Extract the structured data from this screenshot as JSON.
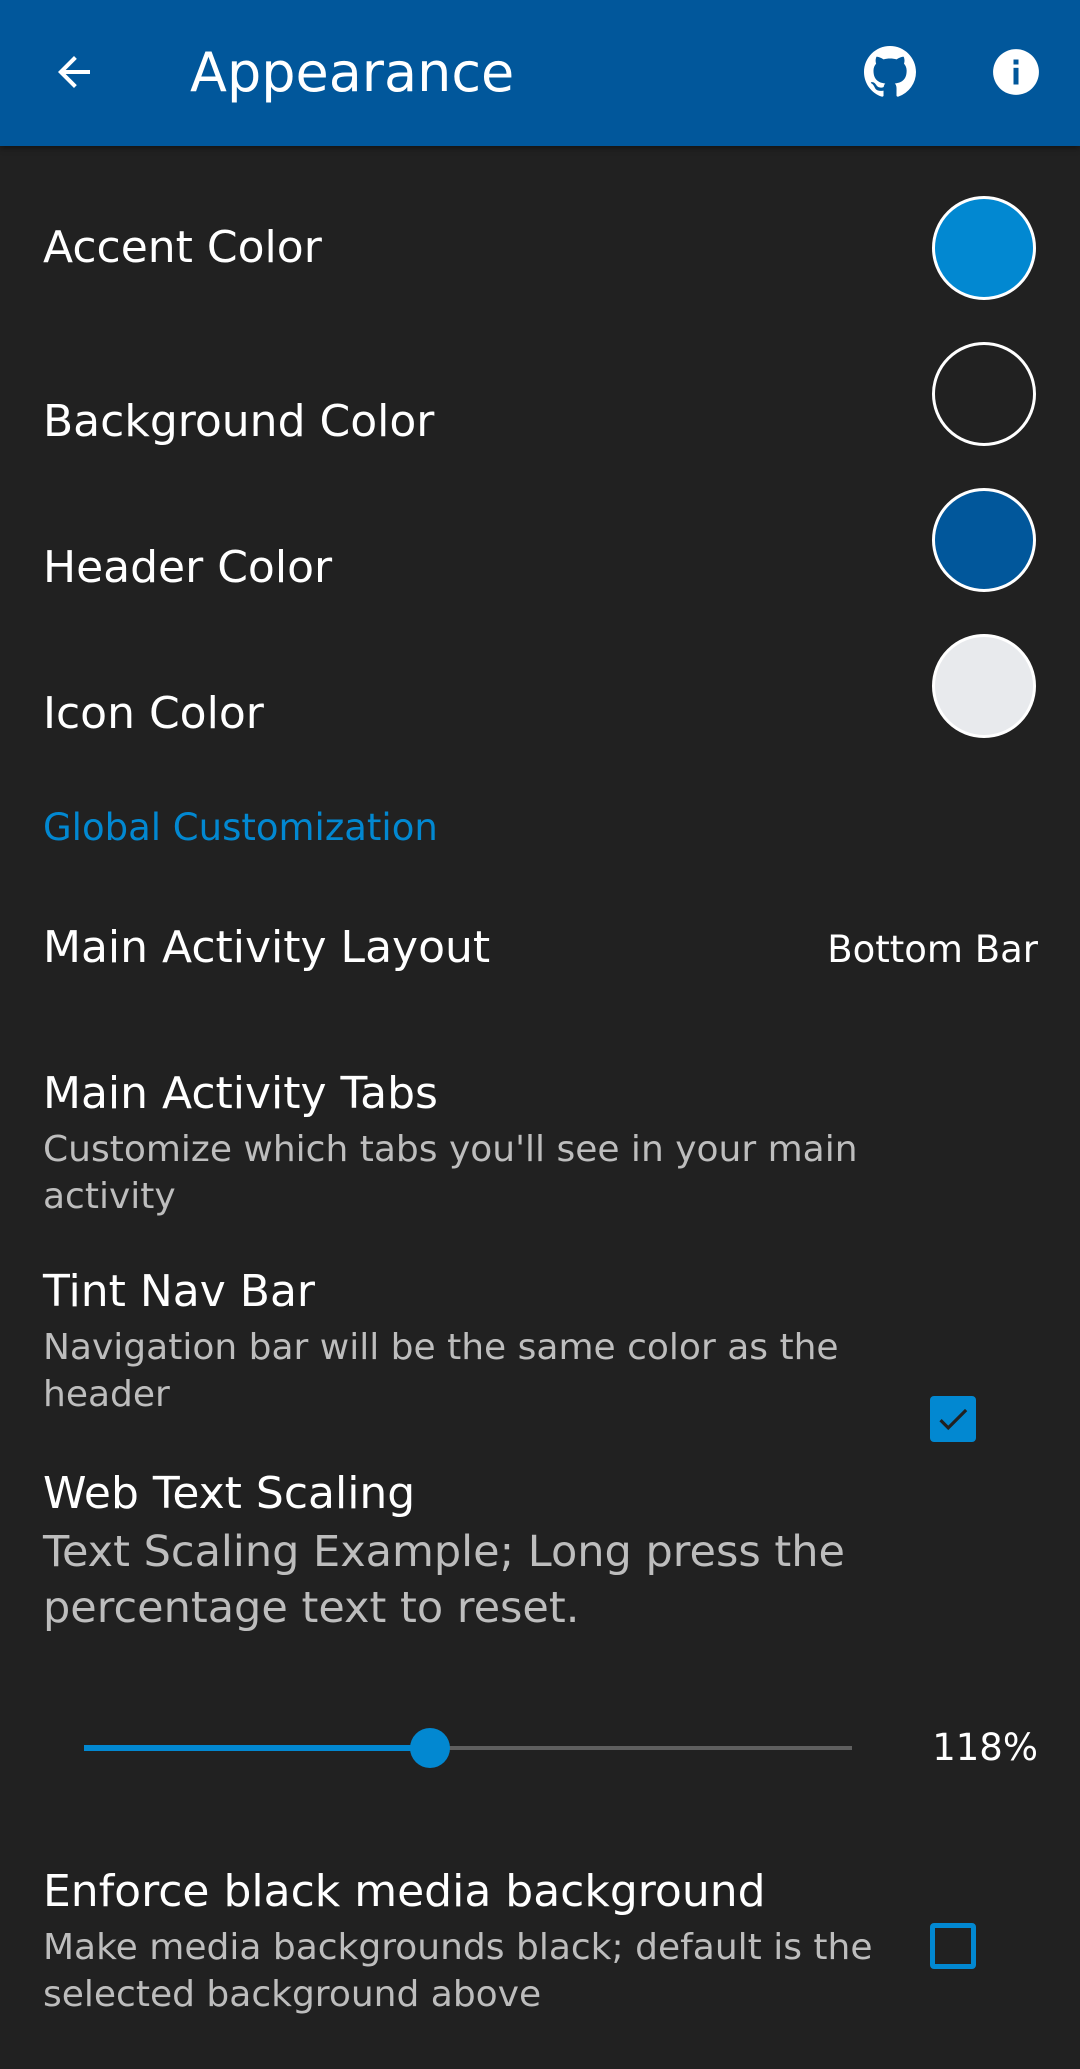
{
  "app_bar": {
    "title": "Appearance",
    "back_icon": "arrow-back-icon",
    "actions": [
      "github-icon",
      "info-icon"
    ],
    "color": "#01579b"
  },
  "colors": {
    "accent": "#0288d1",
    "header": "#01579b",
    "background": "#212121",
    "icon": "#e8eaed"
  },
  "color_rows": [
    {
      "label": "Accent Color",
      "swatch": "#0288d1"
    },
    {
      "label": "Background Color",
      "swatch": "#212121"
    },
    {
      "label": "Header Color",
      "swatch": "#01579b"
    },
    {
      "label": "Icon Color",
      "swatch": "#e8eaed"
    }
  ],
  "global_section": {
    "header": "Global Customization",
    "main_activity_layout": {
      "title": "Main Activity Layout",
      "value": "Bottom Bar"
    },
    "main_activity_tabs": {
      "title": "Main Activity Tabs",
      "summary": "Customize which tabs you'll see in your main activity"
    },
    "tint_nav_bar": {
      "title": "Tint Nav Bar",
      "summary": "Navigation bar will be the same color as the header",
      "checked": true
    },
    "web_text_scaling": {
      "title": "Web Text Scaling",
      "example": "Text Scaling Example; Long press the percentage text to reset.",
      "percent_label": "118%",
      "slider_fraction": 0.45
    },
    "enforce_black_media": {
      "title": "Enforce black media background",
      "summary": "Make media backgrounds black; default is the selected background above",
      "checked": false
    }
  }
}
